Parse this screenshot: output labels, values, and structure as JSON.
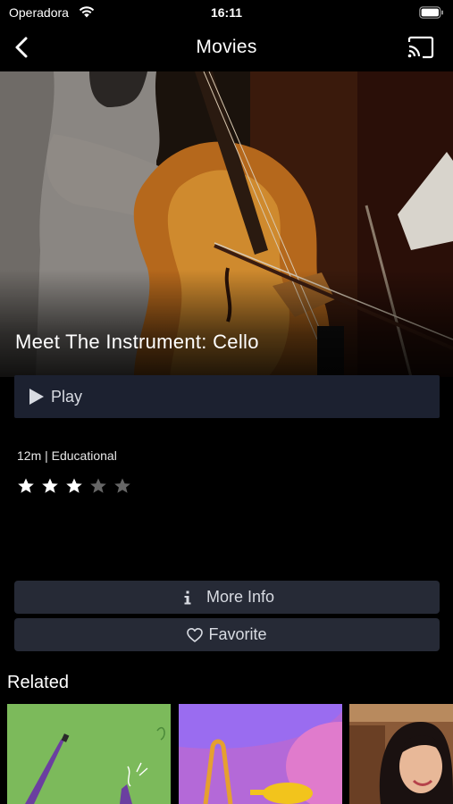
{
  "status_bar": {
    "carrier": "Operadora",
    "time": "16:11"
  },
  "nav": {
    "title": "Movies",
    "back_icon": "chevron-left-icon",
    "cast_icon": "cast-icon"
  },
  "movie": {
    "title": "Meet The Instrument: Cello",
    "play_label": "Play",
    "meta": "12m | Educational",
    "rating": {
      "value": 3,
      "max": 5
    }
  },
  "actions": {
    "more_info_label": "More Info",
    "more_info_icon": "info-icon",
    "favorite_label": "Favorite",
    "favorite_icon": "heart-outline-icon"
  },
  "related": {
    "title": "Related"
  },
  "colors": {
    "background": "#000000",
    "play_button": "#1c2130",
    "secondary_button": "#262a36",
    "star_filled": "#ffffff",
    "star_empty": "#666666"
  }
}
